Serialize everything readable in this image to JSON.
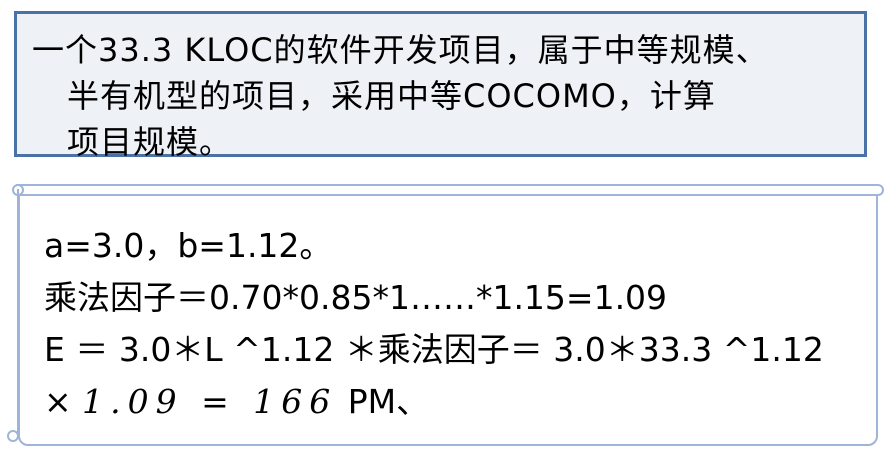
{
  "problem": {
    "line1": "一个33.3 KLOC的软件开发项目，属于中等规模、",
    "line2": "半有机型的项目，采用中等COCOMO，计算",
    "line3": "项目规模。"
  },
  "solution": {
    "line1": "a=3.0，b=1.12。",
    "line2": "乘法因子＝0.70*0.85*1……*1.15=1.09",
    "line3": "E ＝ 3.0＊L ^1.12 ＊乘法因子＝ 3.0＊33.3 ^1.12",
    "line4_prefix": "×",
    "line4_value": "1.09 = 166",
    "line4_suffix": " PM、"
  },
  "colors": {
    "problem_border": "#4a72a6",
    "problem_bg": "#eef2f6",
    "scroll_border": "#9fb4d8"
  }
}
